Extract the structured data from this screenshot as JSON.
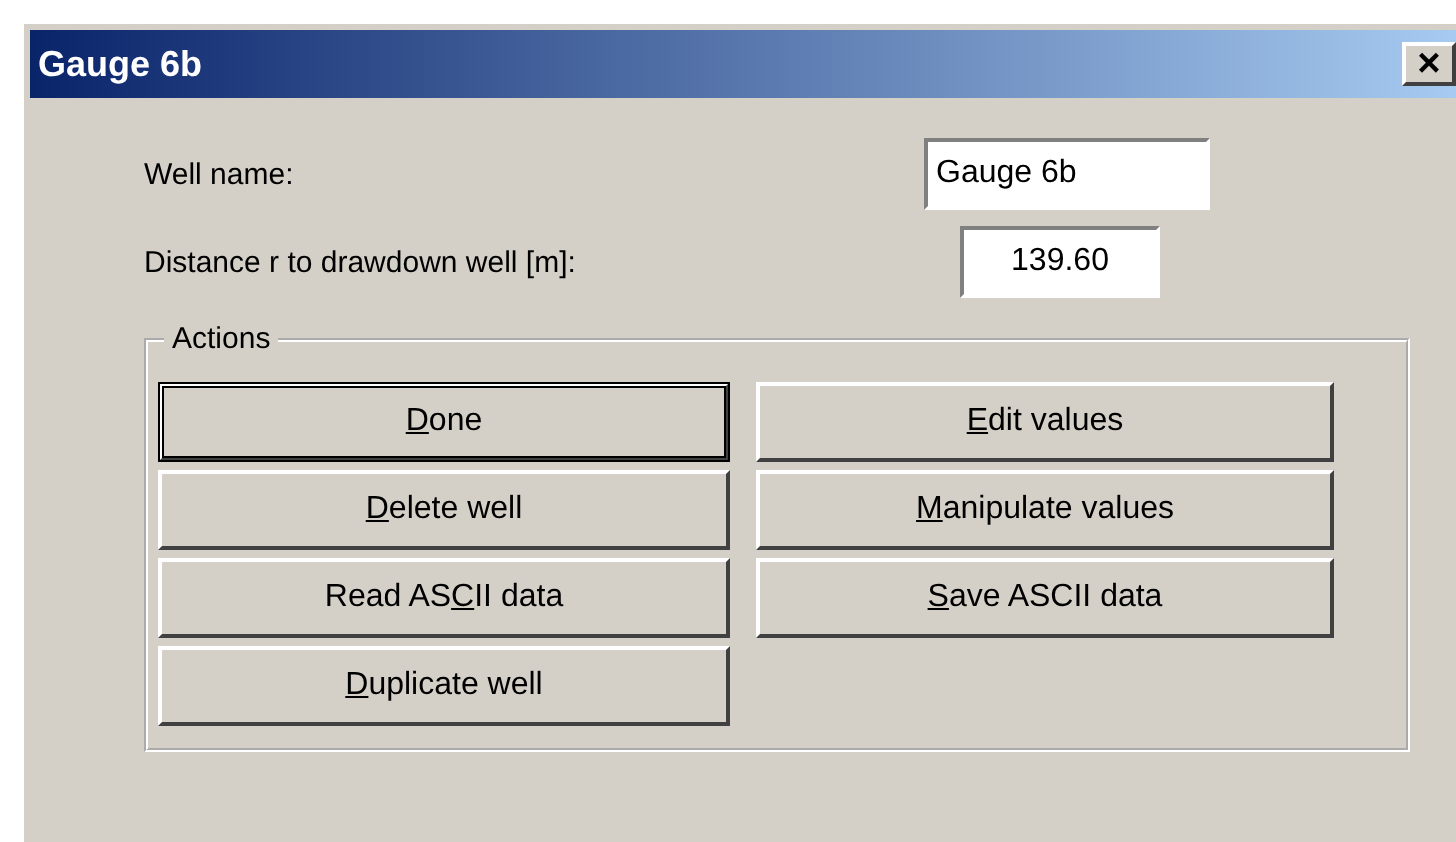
{
  "window": {
    "title": "Gauge 6b",
    "close": "×"
  },
  "fields": [
    {
      "label": "Well name:",
      "value": "Gauge 6b"
    },
    {
      "label": "Distance r to drawdown well [m]:",
      "value": "139.60"
    }
  ],
  "actions": {
    "title": "Actions",
    "buttons": [
      {
        "default": true,
        "label_parts": [
          {
            "text": "D",
            "underlined": true
          },
          {
            "text": "one",
            "underlined": false
          }
        ]
      },
      {
        "default": false,
        "label_parts": [
          {
            "text": "E",
            "underlined": true
          },
          {
            "text": "dit values",
            "underlined": false
          }
        ]
      },
      {
        "default": false,
        "label_parts": [
          {
            "text": "D",
            "underlined": true
          },
          {
            "text": "elete well",
            "underlined": false
          }
        ]
      },
      {
        "default": false,
        "label_parts": [
          {
            "text": "M",
            "underlined": true
          },
          {
            "text": "anipulate values",
            "underlined": false
          }
        ]
      },
      {
        "default": false,
        "label_parts": [
          {
            "text": "Read AS",
            "underlined": false
          },
          {
            "text": "C",
            "underlined": true
          },
          {
            "text": "II data",
            "underlined": false
          }
        ]
      },
      {
        "default": false,
        "label_parts": [
          {
            "text": "S",
            "underlined": true
          },
          {
            "text": "ave ASCII data",
            "underlined": false
          }
        ]
      },
      {
        "default": false,
        "label_parts": [
          {
            "text": "D",
            "underlined": true
          },
          {
            "text": "uplicate well",
            "underlined": false
          }
        ]
      }
    ]
  }
}
